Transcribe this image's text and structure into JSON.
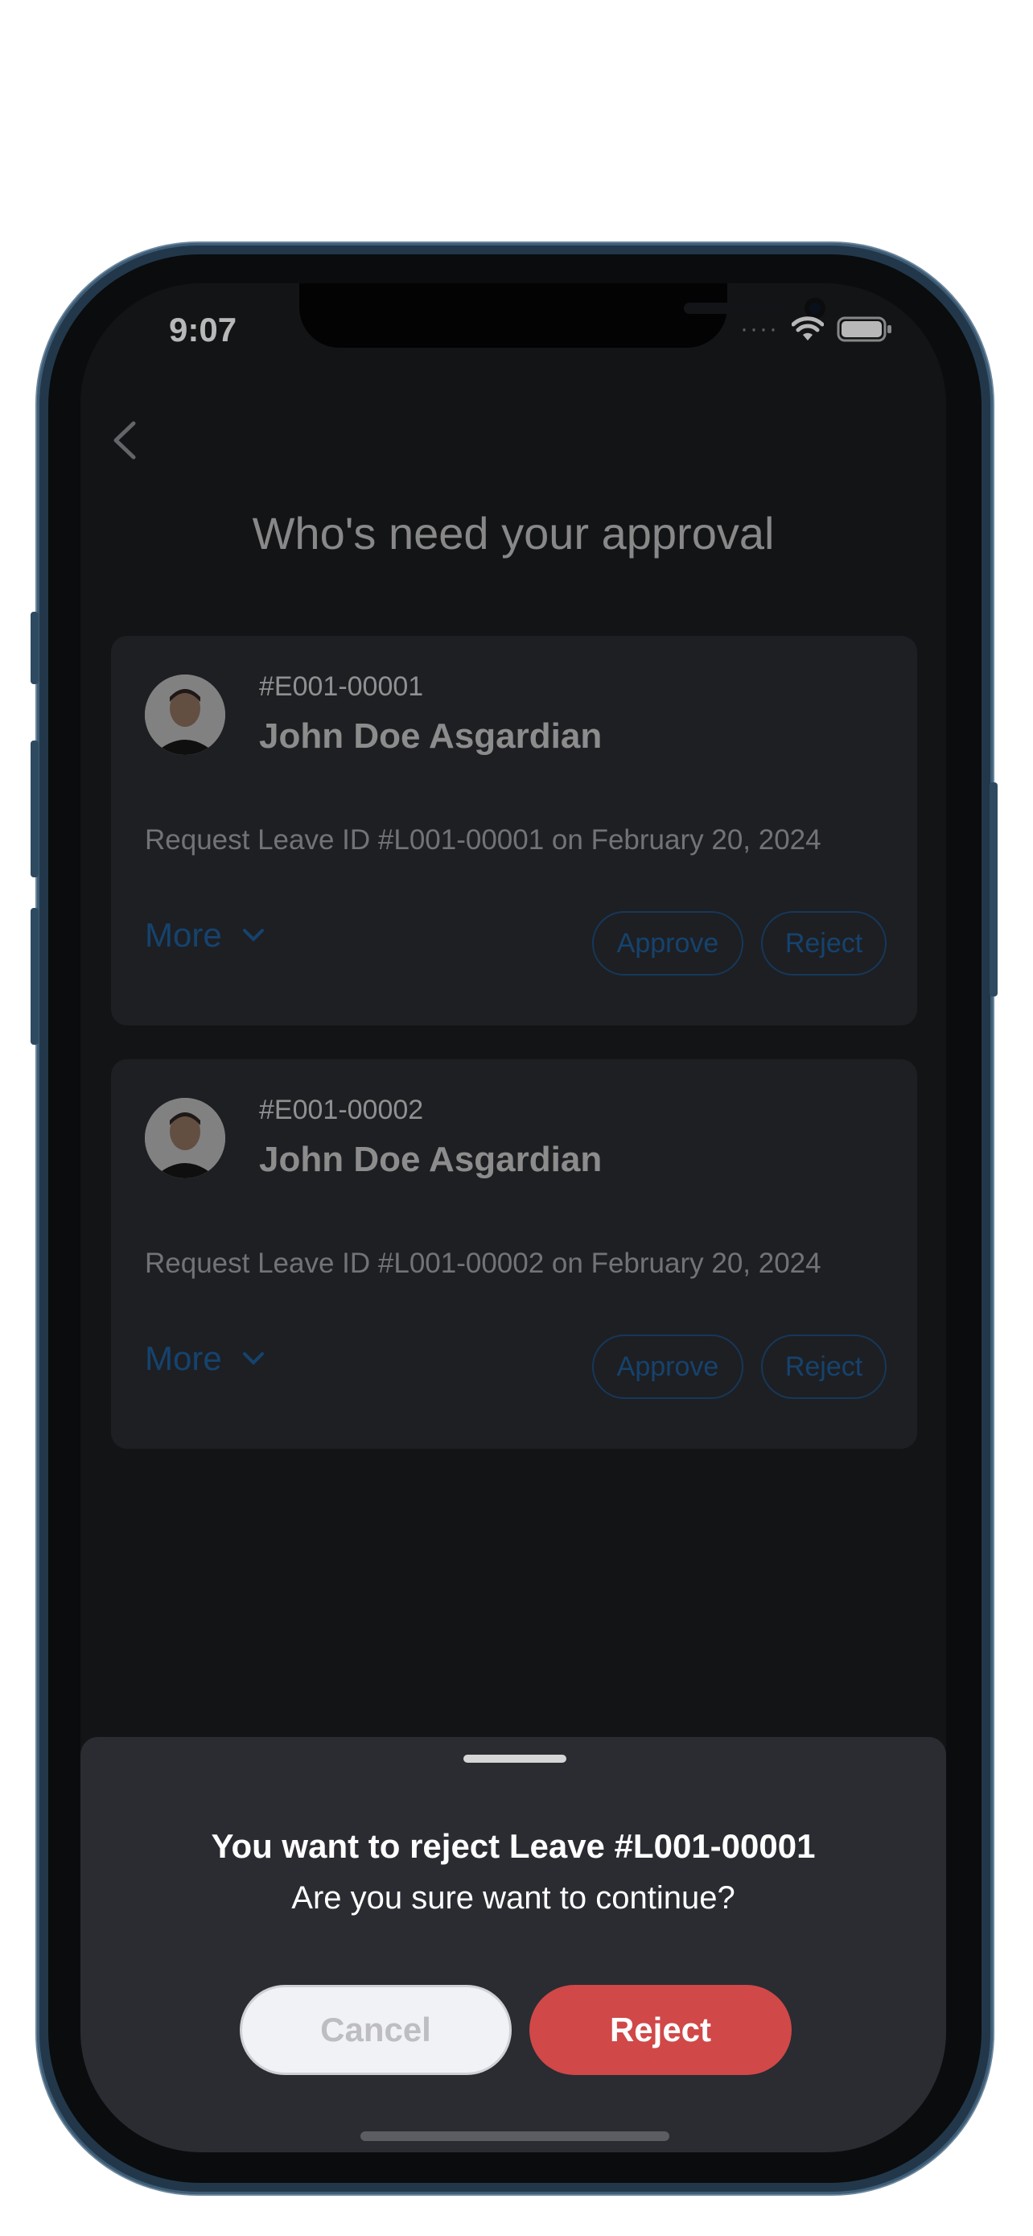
{
  "status_bar": {
    "time": "9:07"
  },
  "header": {
    "title": "Who's need your approval"
  },
  "requests": [
    {
      "employee_id": "#E001-00001",
      "name": "John Doe Asgardian",
      "description": "Request Leave ID #L001-00001 on February 20, 2024",
      "more_label": "More",
      "approve_label": "Approve",
      "reject_label": "Reject"
    },
    {
      "employee_id": "#E001-00002",
      "name": "John Doe Asgardian",
      "description": "Request Leave ID #L001-00002 on February 20, 2024",
      "more_label": "More",
      "approve_label": "Approve",
      "reject_label": "Reject"
    }
  ],
  "sheet": {
    "title": "You want to reject Leave #L001-00001",
    "subtitle": "Are you sure want to continue?",
    "cancel_label": "Cancel",
    "reject_label": "Reject"
  },
  "colors": {
    "accent": "#1e5d99",
    "danger": "#d04848",
    "background": "#1b1c1f",
    "card": "#2a2c31"
  }
}
